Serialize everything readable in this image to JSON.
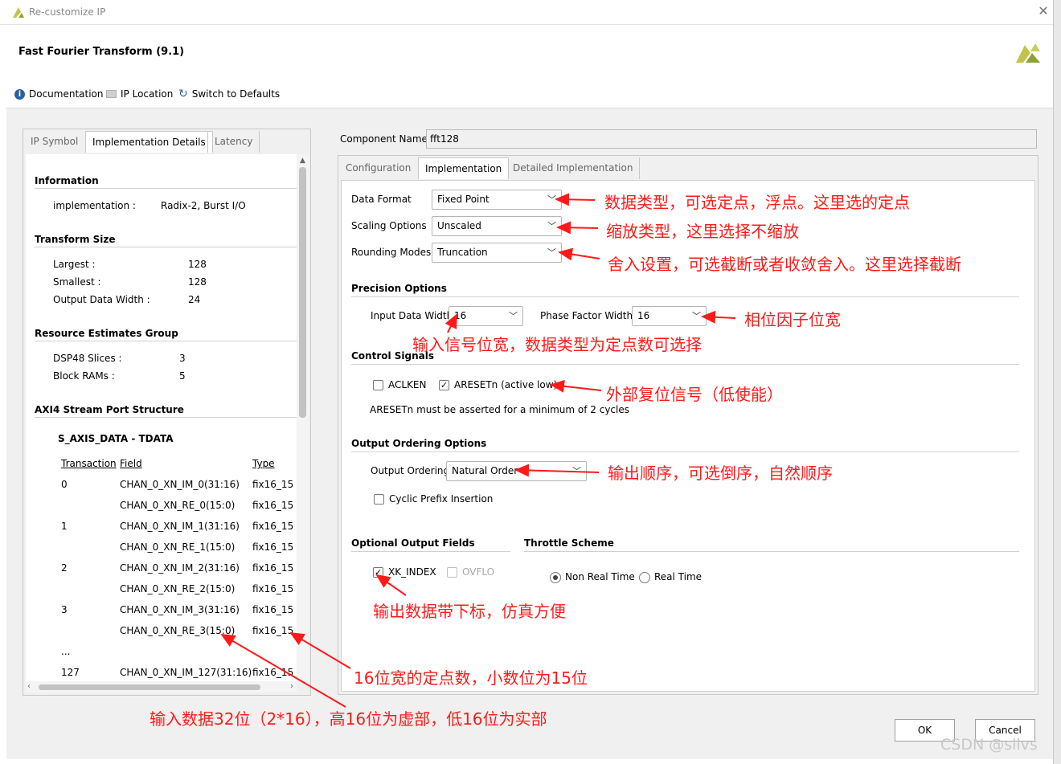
{
  "window": {
    "title": "Re-customize IP",
    "close": "✕"
  },
  "dialog_title": "Fast Fourier Transform (9.1)",
  "toolbar": {
    "documentation": "Documentation",
    "ip_location": "IP Location",
    "switch_defaults": "Switch to Defaults"
  },
  "left_tabs": [
    "IP Symbol",
    "Implementation Details",
    "Latency"
  ],
  "info": {
    "information_h": "Information",
    "implementation_label": "implementation :",
    "implementation_value": "Radix-2, Burst I/O",
    "transform_h": "Transform Size",
    "largest_label": "Largest :",
    "largest_value": "128",
    "smallest_label": "Smallest :",
    "smallest_value": "128",
    "outwidth_label": "Output Data Width :",
    "outwidth_value": "24",
    "resource_h": "Resource Estimates Group",
    "dsp_label": "DSP48 Slices :",
    "dsp_value": "3",
    "bram_label": "Block RAMs :",
    "bram_value": "5",
    "axi_h": "AXI4 Stream Port Structure",
    "tdata_h": "S_AXIS_DATA - TDATA",
    "col_transaction": "Transaction",
    "col_field": "Field",
    "col_type": "Type",
    "rows": [
      {
        "t": "0",
        "f": "CHAN_0_XN_IM_0(31:16)",
        "ty": "fix16_15"
      },
      {
        "t": "",
        "f": "CHAN_0_XN_RE_0(15:0)",
        "ty": "fix16_15"
      },
      {
        "t": "1",
        "f": "CHAN_0_XN_IM_1(31:16)",
        "ty": "fix16_15"
      },
      {
        "t": "",
        "f": "CHAN_0_XN_RE_1(15:0)",
        "ty": "fix16_15"
      },
      {
        "t": "2",
        "f": "CHAN_0_XN_IM_2(31:16)",
        "ty": "fix16_15"
      },
      {
        "t": "",
        "f": "CHAN_0_XN_RE_2(15:0)",
        "ty": "fix16_15"
      },
      {
        "t": "3",
        "f": "CHAN_0_XN_IM_3(31:16)",
        "ty": "fix16_15"
      },
      {
        "t": "",
        "f": "CHAN_0_XN_RE_3(15:0)",
        "ty": "fix16_15"
      },
      {
        "t": "...",
        "f": "",
        "ty": ""
      },
      {
        "t": "127",
        "f": "CHAN_0_XN_IM_127(31:16)",
        "ty": "fix16_15"
      }
    ]
  },
  "component": {
    "label": "Component Name",
    "value": "fft128"
  },
  "right_tabs": [
    "Configuration",
    "Implementation",
    "Detailed Implementation"
  ],
  "impl": {
    "data_format_label": "Data Format",
    "data_format_value": "Fixed Point",
    "scaling_label": "Scaling Options",
    "scaling_value": "Unscaled",
    "rounding_label": "Rounding Modes",
    "rounding_value": "Truncation",
    "precision_h": "Precision Options",
    "input_width_label": "Input Data Width",
    "input_width_value": "16",
    "phase_width_label": "Phase Factor Width",
    "phase_width_value": "16",
    "control_h": "Control Signals",
    "aclken": "ACLKEN",
    "aresetn": "ARESETn (active low)",
    "aresetn_note": "ARESETn must be asserted for a minimum of 2 cycles",
    "ordering_h": "Output Ordering Options",
    "ordering_label": "Output Ordering",
    "ordering_value": "Natural Order",
    "cyclic": "Cyclic Prefix Insertion",
    "optional_h": "Optional Output Fields",
    "throttle_h": "Throttle Scheme",
    "xk_index": "XK_INDEX",
    "ovflo": "OVFLO",
    "non_real_time": "Non Real Time",
    "real_time": "Real Time"
  },
  "annotations": {
    "a1": "数据类型，可选定点，浮点。这里选的定点",
    "a2": "缩放类型，这里选择不缩放",
    "a3": "舍入设置，可选截断或者收敛舍入。这里选择截断",
    "a4": "相位因子位宽",
    "a5": "输入信号位宽，数据类型为定点数可选择",
    "a6": "外部复位信号（低使能）",
    "a7": "输出顺序，可选倒序，自然顺序",
    "a8": "输出数据带下标，仿真方便",
    "a9": "16位宽的定点数，小数位为15位",
    "a10": "输入数据32位（2*16），高16位为虚部，低16位为实部"
  },
  "buttons": {
    "ok": "OK",
    "cancel": "Cancel"
  },
  "watermark": "CSDN @sllvs",
  "colors": {
    "annotation": "#ff1a1a",
    "logo": "#c3c34b"
  }
}
